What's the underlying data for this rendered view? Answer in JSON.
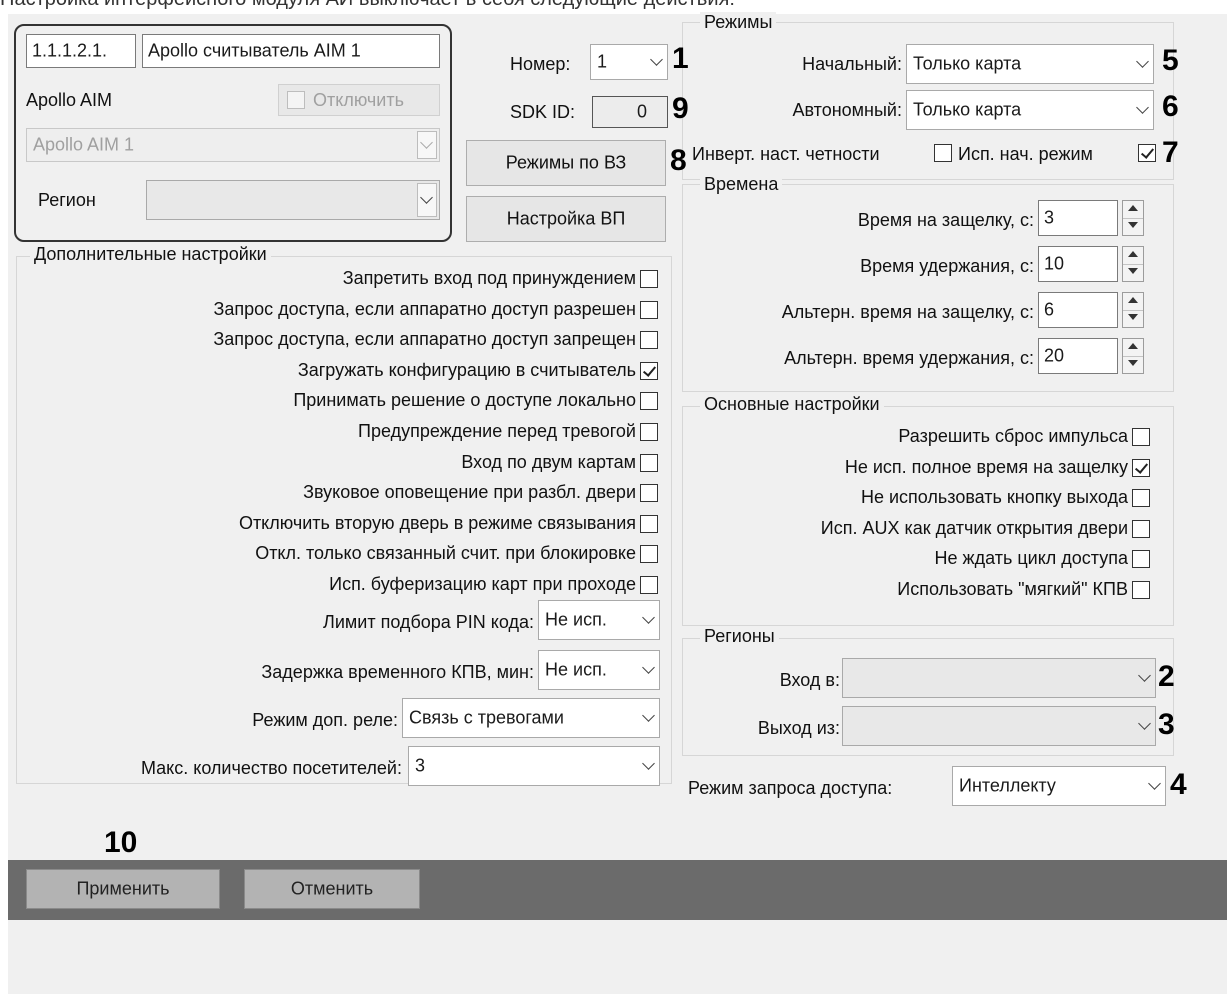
{
  "doc_caption": "Настройка интерфейсного модуля АИ выключает в себя следующие действия:",
  "identity": {
    "id_value": "1.1.1.2.1.",
    "name_value": "Apollo считыватель AIM 1",
    "parent_label": "Apollo AIM",
    "disable_label": "Отключить",
    "disable_checked": false,
    "parent_select_value": "Apollo AIM 1",
    "region_label": "Регион",
    "region_value": ""
  },
  "header_fields": {
    "number_label": "Номер:",
    "number_value": "1",
    "sdk_label": "SDK ID:",
    "sdk_value": "0",
    "modes_button": "Режимы по ВЗ",
    "vp_button": "Настройка ВП"
  },
  "modes": {
    "title": "Режимы",
    "initial_label": "Начальный:",
    "initial_value": "Только карта",
    "autonomous_label": "Автономный:",
    "autonomous_value": "Только карта",
    "invert_label": "Инверт. наст. четности",
    "invert_checked": false,
    "use_initial_label": "Исп. нач. режим",
    "use_initial_checked": true
  },
  "times": {
    "title": "Времена",
    "rows": [
      {
        "label": "Время на защелку, с:",
        "value": "3"
      },
      {
        "label": "Время удержания, с:",
        "value": "10"
      },
      {
        "label": "Альтерн. время на защелку, с:",
        "value": "6"
      },
      {
        "label": "Альтерн. время удержания, с:",
        "value": "20"
      }
    ]
  },
  "additional": {
    "title": "Дополнительные настройки",
    "options": [
      {
        "label": "Запретить вход под принуждением",
        "checked": false
      },
      {
        "label": "Запрос доступа, если аппаратно доступ разрешен",
        "checked": false
      },
      {
        "label": "Запрос доступа, если аппаратно доступ запрещен",
        "checked": false
      },
      {
        "label": "Загружать конфигурацию в считыватель",
        "checked": true
      },
      {
        "label": "Принимать решение о доступе локально",
        "checked": false
      },
      {
        "label": "Предупреждение перед тревогой",
        "checked": false
      },
      {
        "label": "Вход по двум картам",
        "checked": false
      },
      {
        "label": "Звуковое оповещение при разбл. двери",
        "checked": false
      },
      {
        "label": "Отключить вторую дверь в режиме связывания",
        "checked": false
      },
      {
        "label": "Откл. только связанный счит. при блокировке",
        "checked": false
      },
      {
        "label": "Исп. буферизацию карт при проходе",
        "checked": false
      }
    ],
    "pin_limit_label": "Лимит подбора PIN кода:",
    "pin_limit_value": "Не исп.",
    "kpv_delay_label": "Задержка временного КПВ, мин:",
    "kpv_delay_value": "Не исп.",
    "relay_mode_label": "Режим доп. реле:",
    "relay_mode_value": "Связь с тревогами",
    "max_visitors_label": "Макс. количество посетителей:",
    "max_visitors_value": "3"
  },
  "basic": {
    "title": "Основные настройки",
    "options": [
      {
        "label": "Разрешить сброс импульса",
        "checked": false
      },
      {
        "label": "Не исп. полное время на защелку",
        "checked": true
      },
      {
        "label": "Не использовать кнопку выхода",
        "checked": false
      },
      {
        "label": "Исп. AUX как датчик открытия двери",
        "checked": false
      },
      {
        "label": "Не ждать цикл доступа",
        "checked": false
      },
      {
        "label": "Использовать \"мягкий\" КПВ",
        "checked": false
      }
    ]
  },
  "regions": {
    "title": "Регионы",
    "entry_label": "Вход в:",
    "entry_value": "",
    "exit_label": "Выход из:",
    "exit_value": ""
  },
  "access_request": {
    "label": "Режим запроса доступа:",
    "value": "Интеллекту"
  },
  "footer": {
    "apply": "Применить",
    "cancel": "Отменить"
  },
  "annotations": [
    "1",
    "2",
    "3",
    "4",
    "5",
    "6",
    "7",
    "8",
    "9",
    "10"
  ]
}
